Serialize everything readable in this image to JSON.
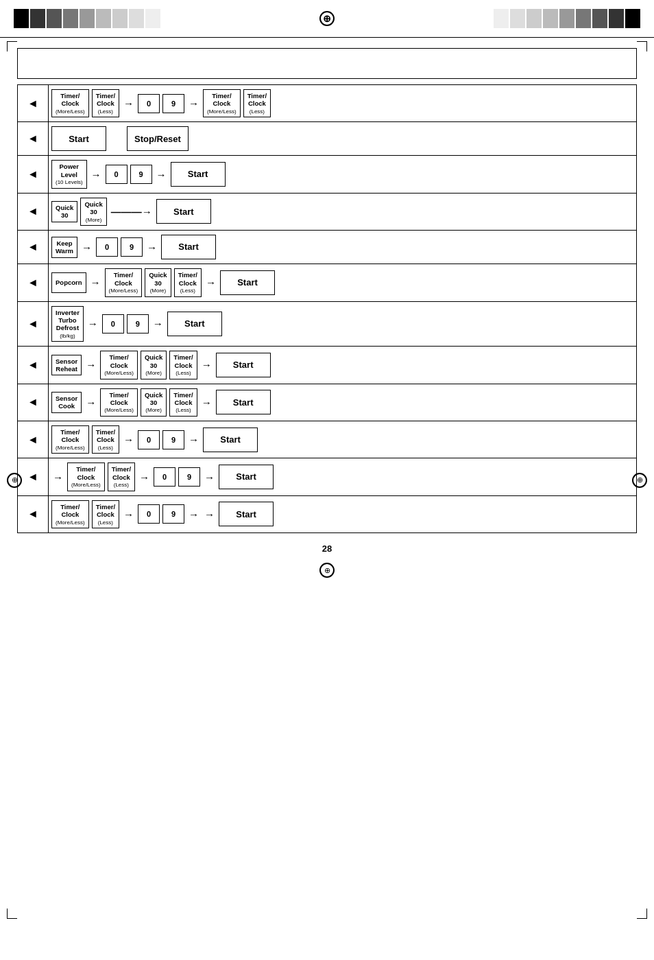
{
  "page": {
    "number": "28"
  },
  "topBar": {
    "leftBlocks": [
      "#000",
      "#222",
      "#444",
      "#666",
      "#888",
      "#aaa",
      "#c4c4c4",
      "#d8d8d8",
      "#ececec"
    ],
    "rightBlocks": [
      "#ececec",
      "#d8d8d8",
      "#c4c4c4",
      "#aaa",
      "#888",
      "#666",
      "#444",
      "#222",
      "#000"
    ]
  },
  "headerBox": {
    "text": ""
  },
  "rows": [
    {
      "id": "row1",
      "hasIcon": true,
      "sequence": "timer_clock_more_less → 0 9 → timer_clock_more_less timer_clock_less"
    },
    {
      "id": "row2",
      "hasIcon": true,
      "sequence": "Start | Stop/Reset"
    },
    {
      "id": "row3",
      "hasIcon": true,
      "sequence": "power_level → 0 9 → Start"
    },
    {
      "id": "row4",
      "hasIcon": true,
      "sequence": "quick30 quick30_more → → Start"
    },
    {
      "id": "row5",
      "hasIcon": true,
      "sequence": "keep_warm → 0 9 → Start"
    },
    {
      "id": "row6",
      "hasIcon": true,
      "sequence": "popcorn → timer_clock_more_less quick30_more timer_clock_less → Start"
    },
    {
      "id": "row7",
      "hasIcon": true,
      "sequence": "inverter_turbo_defrost → 0 9 → Start"
    },
    {
      "id": "row8",
      "hasIcon": true,
      "sequence": "sensor_reheat → timer_clock_more_less quick30_more timer_clock_less → Start"
    },
    {
      "id": "row9",
      "hasIcon": true,
      "sequence": "sensor_cook → timer_clock_more_less quick30_more timer_clock_less → Start"
    },
    {
      "id": "row10",
      "hasIcon": true,
      "sequence": "timer_clock_more_less timer_clock_less → 0 9 → Start"
    },
    {
      "id": "row11",
      "hasIcon": true,
      "sequence": "→ timer_clock_more_less timer_clock_less → 0 9 → Start"
    },
    {
      "id": "row12",
      "hasIcon": true,
      "sequence": "timer_clock_more_less timer_clock_less → 0 9 → → Start"
    }
  ],
  "buttons": {
    "timer_clock_more_less_label1": "Timer/",
    "timer_clock_more_less_label2": "Clock",
    "timer_clock_more_less_sub": "(More/Less)",
    "timer_clock_less_label1": "Timer/",
    "timer_clock_less_label2": "Clock",
    "timer_clock_less_sub": "(Less)",
    "start": "Start",
    "stop_reset": "Stop/Reset",
    "power_level_1": "Power",
    "power_level_2": "Level",
    "power_level_sub": "(10 Levels)",
    "quick30_1": "Quick",
    "quick30_2": "30",
    "quick30_more_1": "Quick",
    "quick30_more_2": "30",
    "quick30_more_sub": "(More)",
    "keep_warm_1": "Keep",
    "keep_warm_2": "Warm",
    "popcorn": "Popcorn",
    "inverter_turbo_1": "Inverter",
    "inverter_turbo_2": "Turbo",
    "inverter_turbo_3": "Defrost",
    "inverter_turbo_sub": "(lb/kg)",
    "sensor_reheat_1": "Sensor",
    "sensor_reheat_2": "Reheat",
    "sensor_cook_1": "Sensor",
    "sensor_cook_2": "Cook",
    "num_0": "0",
    "num_9": "9"
  }
}
